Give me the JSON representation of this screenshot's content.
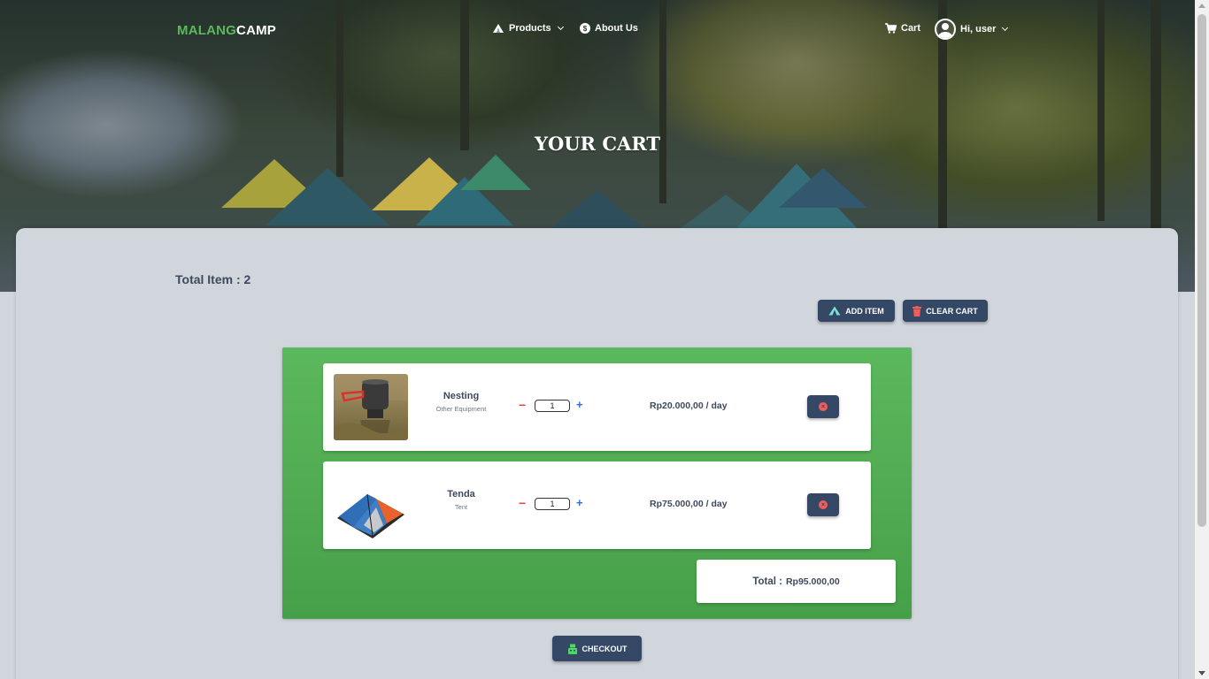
{
  "brand": {
    "part1": "MALANG",
    "part2": "CAMP"
  },
  "nav": {
    "products": "Products",
    "about": "About Us",
    "cart": "Cart",
    "user": "Hi, user",
    "about_icon_glyph": "$"
  },
  "page_title": "YOUR CART",
  "total_item_label": "Total Item : 2",
  "buttons": {
    "add_item": "ADD ITEM",
    "clear_cart": "CLEAR CART",
    "checkout": "CHECKOUT"
  },
  "cart_items": [
    {
      "name": "Nesting",
      "category": "Other Equipment",
      "quantity": "1",
      "price": "Rp20.000,00 / day",
      "remove_glyph": "×"
    },
    {
      "name": "Tenda",
      "category": "Tent",
      "quantity": "1",
      "price": "Rp75.000,00 / day",
      "remove_glyph": "×"
    }
  ],
  "qty_controls": {
    "minus": "−",
    "plus": "+"
  },
  "total": {
    "label": "Total :",
    "value": "Rp95.000,00"
  },
  "colors": {
    "brand_green": "#5cb85c",
    "button_navy": "#344866",
    "panel_green": "#4caf50",
    "text_dark": "#3d4a5d",
    "remove_red": "#f25c5c"
  },
  "icons": {
    "products": "tent-icon",
    "about": "coin-icon",
    "cart": "cart-icon",
    "user": "user-avatar-icon",
    "add_item": "tent-icon",
    "clear_cart": "trash-icon",
    "checkout": "register-icon",
    "remove": "close-circle-icon"
  }
}
